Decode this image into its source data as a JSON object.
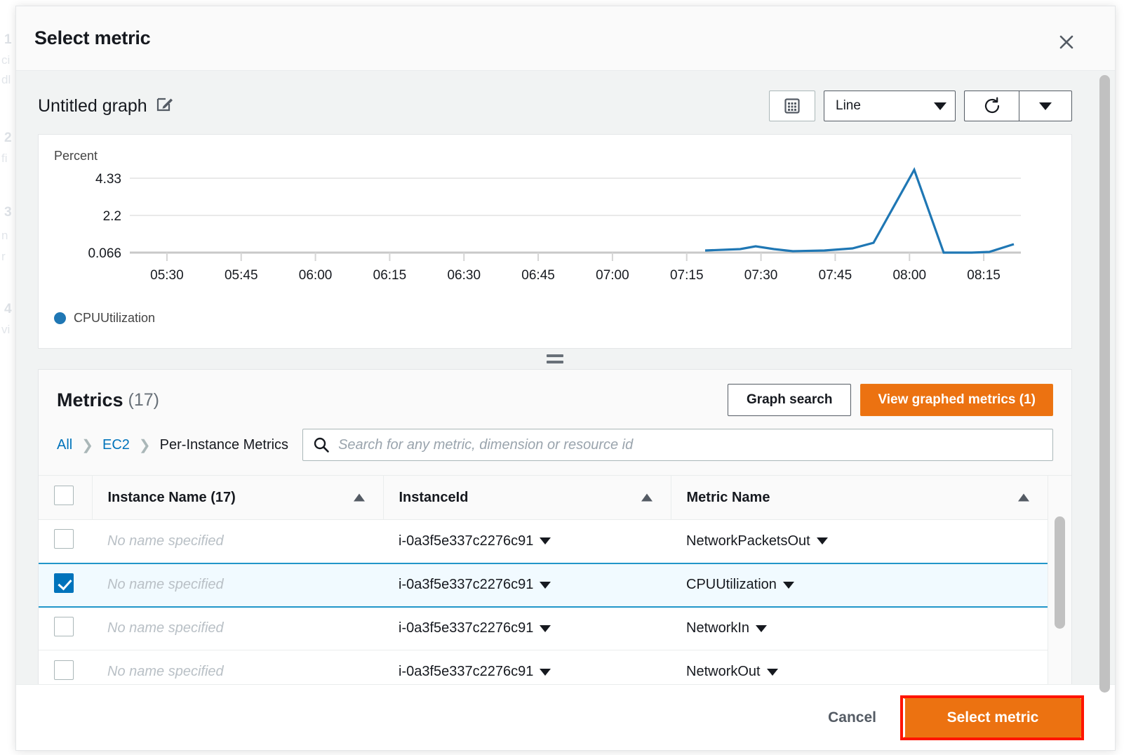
{
  "backdrop": {
    "lines": [
      {
        "num": "1",
        "text": "ci"
      },
      {
        "num": "",
        "text": "dl"
      },
      {
        "num": "2",
        "text": "fi"
      },
      {
        "num": "3",
        "text": "n"
      },
      {
        "num": "",
        "text": "r"
      },
      {
        "num": "4",
        "text": "vi"
      }
    ]
  },
  "modal": {
    "title": "Select metric",
    "close_icon": "close-icon"
  },
  "graph": {
    "title": "Untitled graph",
    "edit_icon": "edit-pencil-icon",
    "grid_icon": "grid-view-icon",
    "chart_type": "Line",
    "refresh_icon": "refresh-icon",
    "refresh_dropdown_icon": "chevron-down-icon",
    "legend_color": "#1f77b4"
  },
  "chart_data": {
    "type": "line",
    "title": "",
    "ylabel": "Percent",
    "xlabel": "",
    "grid": true,
    "legend": [
      {
        "name": "CPUUtilization",
        "color": "#1f77b4"
      }
    ],
    "ytick_labels": [
      "4.33",
      "2.2",
      "0.066"
    ],
    "ylim": [
      0.066,
      4.33
    ],
    "xtick_labels": [
      "05:30",
      "05:45",
      "06:00",
      "06:15",
      "06:30",
      "06:45",
      "07:00",
      "07:15",
      "07:30",
      "07:45",
      "08:00",
      "08:15"
    ],
    "series": [
      {
        "name": "CPUUtilization",
        "color": "#1f77b4",
        "x": [
          "07:22",
          "07:27",
          "07:32",
          "07:37",
          "07:42",
          "07:47",
          "07:52",
          "07:57",
          "08:02",
          "08:07",
          "08:12",
          "08:17",
          "08:22"
        ],
        "values": [
          0.12,
          0.16,
          0.33,
          0.2,
          0.1,
          0.12,
          0.2,
          0.4,
          4.33,
          0.066,
          0.066,
          0.1,
          0.4
        ]
      }
    ]
  },
  "metrics": {
    "heading": "Metrics",
    "count": "(17)",
    "graph_search_label": "Graph search",
    "view_graphed_label": "View graphed metrics (1)",
    "breadcrumb": [
      {
        "label": "All",
        "link": true
      },
      {
        "label": "EC2",
        "link": true
      },
      {
        "label": "Per-Instance Metrics",
        "link": false
      }
    ],
    "search_placeholder": "Search for any metric, dimension or resource id",
    "search_value": "",
    "search_icon": "search-icon",
    "columns": [
      {
        "label": "Instance Name  (17)",
        "sort": "asc"
      },
      {
        "label": "InstanceId",
        "sort": "asc"
      },
      {
        "label": "Metric Name",
        "sort": "asc"
      }
    ],
    "rows": [
      {
        "selected": false,
        "name": "No name specified",
        "instance_id": "i-0a3f5e337c2276c91",
        "metric_name": "NetworkPacketsOut"
      },
      {
        "selected": true,
        "name": "No name specified",
        "instance_id": "i-0a3f5e337c2276c91",
        "metric_name": "CPUUtilization"
      },
      {
        "selected": false,
        "name": "No name specified",
        "instance_id": "i-0a3f5e337c2276c91",
        "metric_name": "NetworkIn"
      },
      {
        "selected": false,
        "name": "No name specified",
        "instance_id": "i-0a3f5e337c2276c91",
        "metric_name": "NetworkOut"
      }
    ]
  },
  "footer": {
    "cancel_label": "Cancel",
    "select_label": "Select metric",
    "highlight_color": "#ff1400"
  }
}
